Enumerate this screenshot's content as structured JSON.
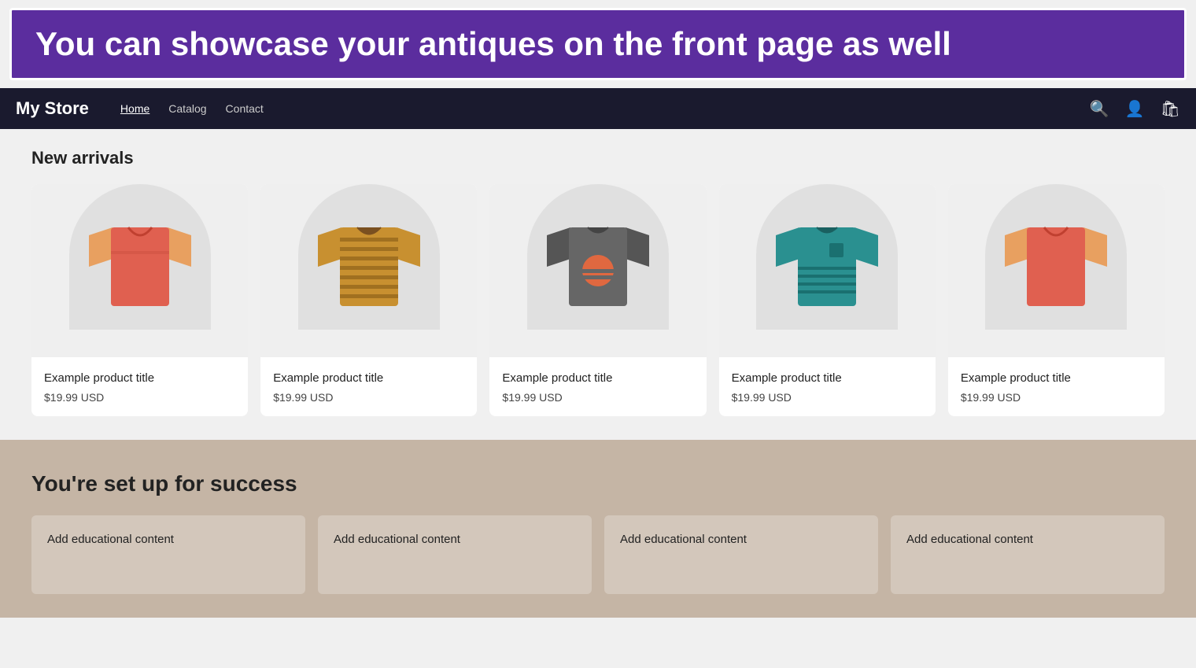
{
  "banner": {
    "text": "You can showcase your antiques on the front page as well",
    "border_color": "#ffffff",
    "bg_color": "#5b2d9e"
  },
  "navbar": {
    "store_name": "My Store",
    "links": [
      {
        "label": "Home",
        "active": true
      },
      {
        "label": "Catalog",
        "active": false
      },
      {
        "label": "Contact",
        "active": false
      }
    ],
    "icons": [
      "search-icon",
      "user-icon",
      "cart-icon"
    ]
  },
  "main": {
    "section_title": "New arrivals",
    "products": [
      {
        "title": "Example product title",
        "price": "$19.99 USD",
        "shirt_color": "#e06050",
        "stripe_color": "#c04030",
        "collar_color": "#c9443a",
        "sleeve_color": "#e8a060"
      },
      {
        "title": "Example product title",
        "price": "$19.99 USD",
        "shirt_color": "#c89030",
        "stripe_color": "#a07020",
        "collar_color": "#7a5020",
        "sleeve_color": "#c89030"
      },
      {
        "title": "Example product title",
        "price": "$19.99 USD",
        "shirt_color": "#666666",
        "stripe_color": "#555555",
        "collar_color": "#444444",
        "sleeve_color": "#555555"
      },
      {
        "title": "Example product title",
        "price": "$19.99 USD",
        "shirt_color": "#2a9090",
        "stripe_color": "#1a7070",
        "collar_color": "#1a7070",
        "sleeve_color": "#2a9090"
      },
      {
        "title": "Example product title",
        "price": "$19.99 USD",
        "shirt_color": "#e06050",
        "stripe_color": "#c04030",
        "collar_color": "#c9443a",
        "sleeve_color": "#e8a060"
      }
    ]
  },
  "success": {
    "title": "You're set up for success",
    "edu_cards": [
      {
        "text": "Add educational content"
      },
      {
        "text": "Add educational content"
      },
      {
        "text": "Add educational content"
      },
      {
        "text": "Add educational content"
      }
    ]
  }
}
